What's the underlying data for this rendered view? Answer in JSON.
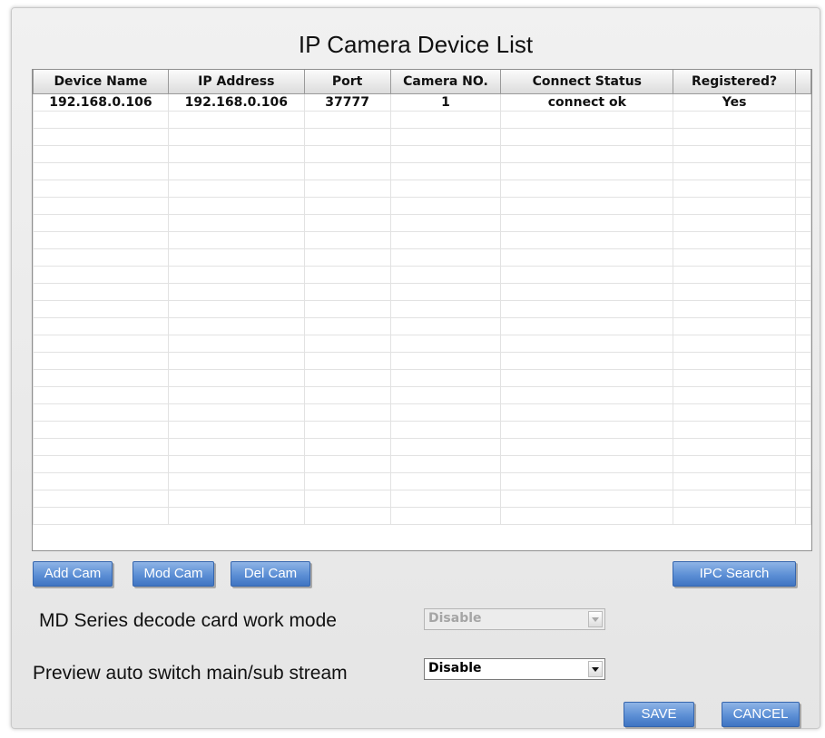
{
  "title": "IP Camera Device List",
  "table": {
    "columns": [
      "Device Name",
      "IP Address",
      "Port",
      "Camera NO.",
      "Connect Status",
      "Registered?"
    ],
    "rows": [
      [
        "192.168.0.106",
        "192.168.0.106",
        "37777",
        "1",
        "connect ok",
        "Yes"
      ]
    ]
  },
  "buttons": {
    "add_cam": "Add Cam",
    "mod_cam": "Mod Cam",
    "del_cam": "Del Cam",
    "ipc_search": "IPC Search",
    "save": "SAVE",
    "cancel": "CANCEL"
  },
  "settings": {
    "md_mode_label": "MD Series decode card work mode",
    "md_mode_value": "Disable",
    "preview_label": "Preview auto switch main/sub stream",
    "preview_value": "Disable"
  },
  "icons": {
    "dropdown": "chevron-down-icon"
  },
  "colors": {
    "button_accent": "#5c8fd5",
    "window_background": "#e9e9e9"
  }
}
